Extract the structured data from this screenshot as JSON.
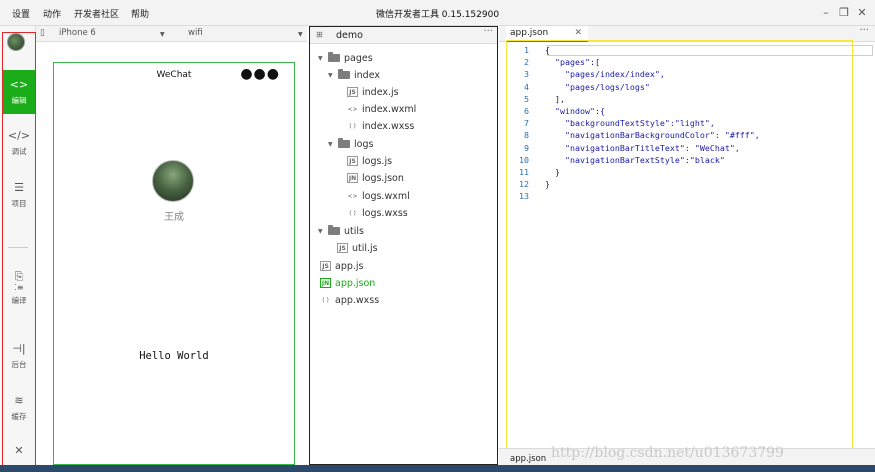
{
  "menubar": {
    "items": [
      "设置",
      "动作",
      "开发者社区",
      "帮助"
    ],
    "title": "微信开发者工具 0.15.152900"
  },
  "sidebar": {
    "items": [
      {
        "label": "编辑",
        "icon": "code-bracket-icon",
        "active": true
      },
      {
        "label": "调试",
        "icon": "debug-code-icon",
        "active": false
      },
      {
        "label": "项目",
        "icon": "menu-lines-icon",
        "active": false
      },
      {
        "label": "编译",
        "icon": "compile-icon",
        "active": false
      },
      {
        "label": "后台",
        "icon": "background-icon",
        "active": false
      },
      {
        "label": "缓存",
        "icon": "layers-icon",
        "active": false
      }
    ]
  },
  "device_bar": {
    "device": "iPhone 6",
    "network": "wifi"
  },
  "simulator": {
    "nav_title": "WeChat",
    "user_name": "王成",
    "hello": "Hello World"
  },
  "file_tree": {
    "root": "demo",
    "nodes": [
      {
        "label": "pages",
        "type": "folder"
      },
      {
        "label": "index",
        "type": "folder"
      },
      {
        "label": "index.js",
        "type": "js"
      },
      {
        "label": "index.wxml",
        "type": "wxml"
      },
      {
        "label": "index.wxss",
        "type": "wxss"
      },
      {
        "label": "logs",
        "type": "folder"
      },
      {
        "label": "logs.js",
        "type": "js"
      },
      {
        "label": "logs.json",
        "type": "json"
      },
      {
        "label": "logs.wxml",
        "type": "wxml"
      },
      {
        "label": "logs.wxss",
        "type": "wxss"
      },
      {
        "label": "utils",
        "type": "folder"
      },
      {
        "label": "util.js",
        "type": "js"
      },
      {
        "label": "app.js",
        "type": "js"
      },
      {
        "label": "app.json",
        "type": "json",
        "selected": true
      },
      {
        "label": "app.wxss",
        "type": "wxss"
      }
    ]
  },
  "editor": {
    "tab_label": "app.json",
    "footer_file": "app.json",
    "lines": [
      {
        "n": "1",
        "text": "{"
      },
      {
        "n": "2",
        "text": "  \"pages\":["
      },
      {
        "n": "3",
        "text": "    \"pages/index/index\","
      },
      {
        "n": "4",
        "text": "    \"pages/logs/logs\""
      },
      {
        "n": "5",
        "text": "  ],"
      },
      {
        "n": "6",
        "text": "  \"window\":{"
      },
      {
        "n": "7",
        "text": "    \"backgroundTextStyle\":\"light\","
      },
      {
        "n": "8",
        "text": "    \"navigationBarBackgroundColor\": \"#fff\","
      },
      {
        "n": "9",
        "text": "    \"navigationBarTitleText\": \"WeChat\","
      },
      {
        "n": "10",
        "text": "    \"navigationBarTextStyle\":\"black\""
      },
      {
        "n": "11",
        "text": "  }"
      },
      {
        "n": "12",
        "text": "}"
      },
      {
        "n": "13",
        "text": ""
      }
    ],
    "watermark": "http://blog.csdn.net/u013673799"
  },
  "colors": {
    "accent": "#1aad19",
    "sidebar_frame": "#e0282b",
    "editor_frame": "#f7e53b",
    "simulator_frame": "#39b54a"
  }
}
